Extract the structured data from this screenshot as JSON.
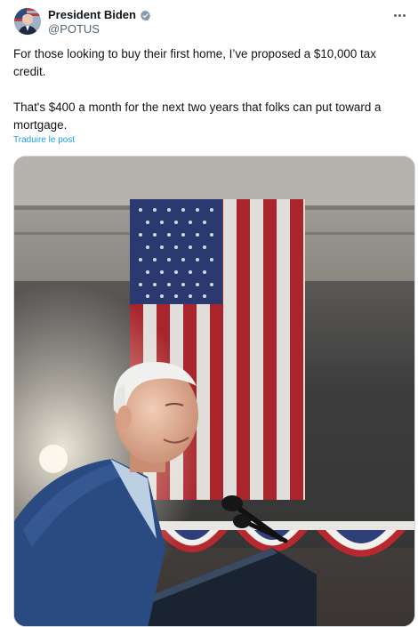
{
  "author": {
    "name": "President Biden",
    "handle": "@POTUS",
    "verified_icon": "verified-badge-icon",
    "avatar_icon": "avatar-icon"
  },
  "tweet": {
    "paragraph_1": "For those looking to buy their first home, I’ve proposed a $10,000 tax credit.",
    "paragraph_2": "That's $400 a month for the next two years that folks can put toward a mortgage.",
    "translate_label": "Traduire le post"
  },
  "menu": {
    "icon": "more-options-icon"
  },
  "media": {
    "icon": "photo"
  },
  "colors": {
    "text": "#0f1419",
    "secondary": "#536471",
    "link": "#1d9bf0",
    "verified": "#829aab"
  }
}
